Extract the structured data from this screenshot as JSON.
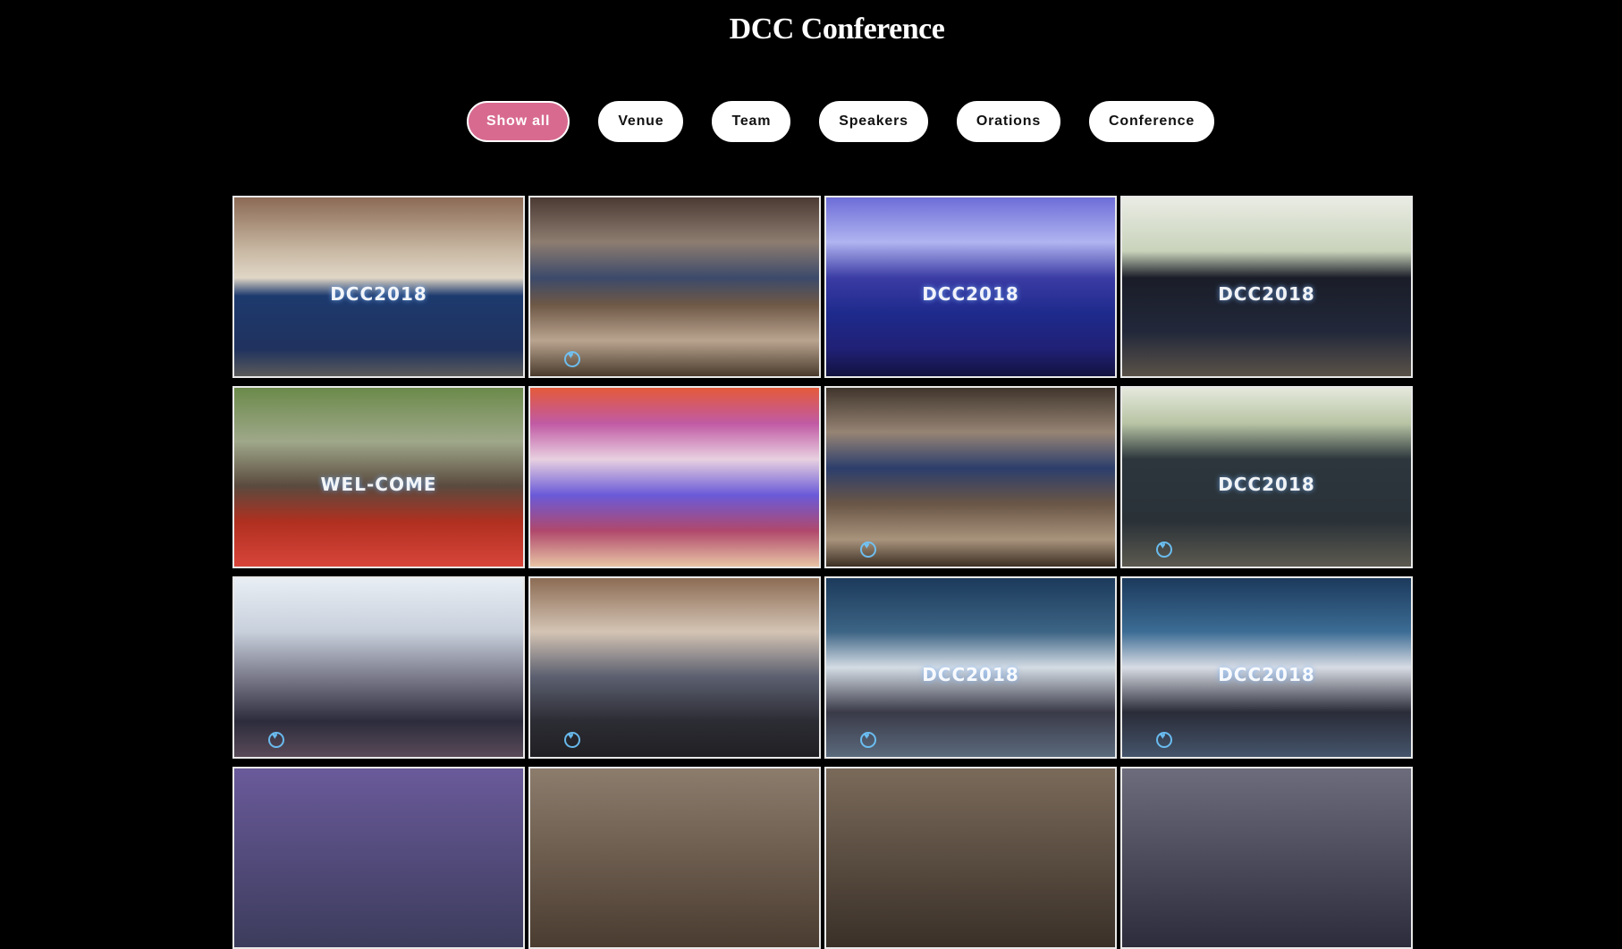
{
  "page": {
    "title": "DCC Conference"
  },
  "filters": [
    {
      "label": "Show all",
      "active": true
    },
    {
      "label": "Venue",
      "active": false
    },
    {
      "label": "Team",
      "active": false
    },
    {
      "label": "Speakers",
      "active": false
    },
    {
      "label": "Orations",
      "active": false
    },
    {
      "label": "Conference",
      "active": false
    }
  ],
  "colors": {
    "background": "#000000",
    "active_filter": "#d86a90",
    "filter": "#ffffff"
  },
  "gallery": {
    "tiles": [
      {
        "name": "venue-entrance-photo",
        "caption": "DCC2018",
        "bg": "linear-gradient(180deg,#8b6a55 0%,#c9b9a4 30%,#e0d6c6 45%,#1d3a6e 55%,#20325e 85%,#5a5a5a 100%)",
        "icon": false
      },
      {
        "name": "banquet-hall-photo",
        "caption": "",
        "bg": "linear-gradient(180deg,#4a3a33 0%,#8d7d70 25%,#3c4a6a 45%,#6e5846 60%,#b9a48f 80%,#4a3b2d 100%)",
        "icon": true
      },
      {
        "name": "stage-blue-photo",
        "caption": "DCC2018",
        "bg": "linear-gradient(180deg,#6d6dd8 0%,#b0b4f0 25%,#3b3ba4 45%,#1e2a8c 65%,#202075 85%,#121240 100%)",
        "icon": false
      },
      {
        "name": "registration-desk-photo",
        "caption": "DCC2018",
        "bg": "linear-gradient(180deg,#e9ece4 0%,#c9d3bb 30%,#1a1d28 45%,#22283a 75%,#5a5248 100%)",
        "icon": false
      },
      {
        "name": "welcome-arch-photo",
        "caption": "WEL-COME",
        "bg": "linear-gradient(180deg,#6b8a4a 0%,#9fa88a 30%,#5a4a3e 55%,#b03020 75%,#d8443a 100%)",
        "icon": false
      },
      {
        "name": "pool-canopy-photo",
        "caption": "",
        "bg": "linear-gradient(180deg,#e45a3a 0%,#c05aa4 20%,#e8d0e0 40%,#6a5ad8 60%,#b0486c 80%,#e8c4a4 100%)",
        "icon": false
      },
      {
        "name": "banquet-hall-wide-photo",
        "caption": "",
        "bg": "linear-gradient(180deg,#40352c 0%,#968474 25%,#2c3e6c 45%,#6a5646 65%,#a8937c 85%,#3c2f24 100%)",
        "icon": true
      },
      {
        "name": "conference-board-photo",
        "caption": "DCC2018",
        "bg": "linear-gradient(180deg,#e4e8dc 0%,#b8c4a4 20%,#2c363c 40%,#2a3238 75%,#5c5a50 100%)",
        "icon": true
      },
      {
        "name": "delegates-crowd-photo",
        "caption": "",
        "bg": "linear-gradient(180deg,#e8eef4 0%,#c8d0dc 30%,#7c7c8c 55%,#2c2c3c 80%,#5a4a58 100%)",
        "icon": true
      },
      {
        "name": "delegates-hall-photo",
        "caption": "",
        "bg": "linear-gradient(180deg,#8c6c54 0%,#d4c4b4 30%,#5c6070 55%,#2c2c34 80%,#202024 100%)",
        "icon": true
      },
      {
        "name": "team-group-photo",
        "caption": "DCC2018",
        "bg": "linear-gradient(180deg,#1c3a5c 0%,#3c6484 30%,#d4dce4 50%,#3a3a48 75%,#5a6a7c 100%)",
        "icon": true
      },
      {
        "name": "team-group-photo-2",
        "caption": "DCC2018",
        "bg": "linear-gradient(180deg,#1c3a5c 0%,#3c6c94 30%,#d8dce4 50%,#2a2c38 75%,#44546a 100%)",
        "icon": true
      },
      {
        "name": "row4-photo-1",
        "caption": "",
        "bg": "linear-gradient(180deg,#6a5a9a 0%,#3c3c5c 100%)",
        "icon": false
      },
      {
        "name": "row4-photo-2",
        "caption": "",
        "bg": "linear-gradient(180deg,#8c7c6c 0%,#4a3c30 100%)",
        "icon": false
      },
      {
        "name": "row4-photo-3",
        "caption": "",
        "bg": "linear-gradient(180deg,#7a6a5a 0%,#3a3028 100%)",
        "icon": false
      },
      {
        "name": "row4-photo-4",
        "caption": "",
        "bg": "linear-gradient(180deg,#6c6c7c 0%,#2c2c3c 100%)",
        "icon": false
      }
    ]
  }
}
